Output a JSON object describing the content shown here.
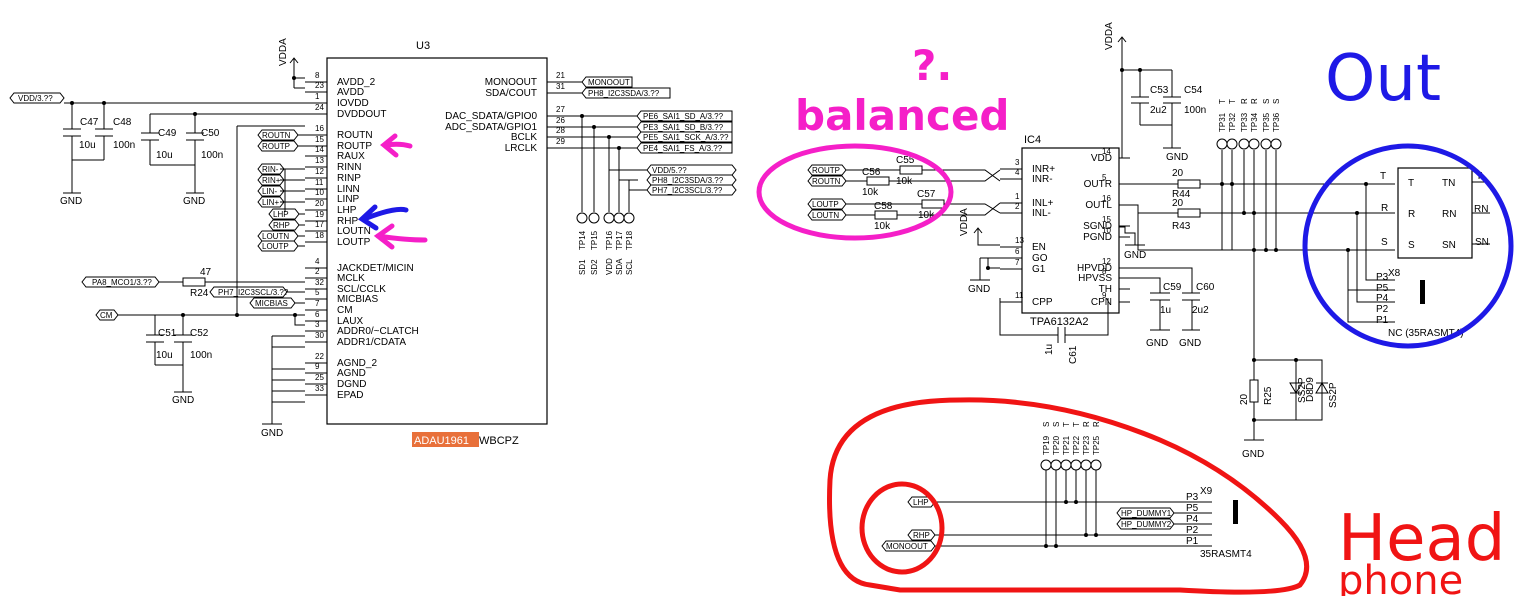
{
  "u3": {
    "ref": "U3",
    "part_highlight": "ADAU1961",
    "part_suffix": "WBCPZ",
    "left_pins": [
      {
        "num": "8",
        "name": "AVDD_2"
      },
      {
        "num": "23",
        "name": "AVDD"
      },
      {
        "num": "1",
        "name": "IOVDD"
      },
      {
        "num": "24",
        "name": "DVDDOUT"
      },
      {
        "num": "16",
        "name": "ROUTN"
      },
      {
        "num": "15",
        "name": "ROUTP"
      },
      {
        "num": "14",
        "name": "RAUX"
      },
      {
        "num": "13",
        "name": "RINN"
      },
      {
        "num": "12",
        "name": "RINP"
      },
      {
        "num": "11",
        "name": "LINN"
      },
      {
        "num": "10",
        "name": "LINP"
      },
      {
        "num": "20",
        "name": "LHP"
      },
      {
        "num": "19",
        "name": "RHP"
      },
      {
        "num": "17",
        "name": "LOUTN"
      },
      {
        "num": "18",
        "name": "LOUTP"
      },
      {
        "num": "4",
        "name": "JACKDET/MICIN"
      },
      {
        "num": "2",
        "name": "MCLK"
      },
      {
        "num": "32",
        "name": "SCL/CCLK"
      },
      {
        "num": "5",
        "name": "MICBIAS"
      },
      {
        "num": "7",
        "name": "CM"
      },
      {
        "num": "6",
        "name": "LAUX"
      },
      {
        "num": "3",
        "name": "ADDR0/~CLATCH"
      },
      {
        "num": "30",
        "name": "ADDR1/CDATA"
      },
      {
        "num": "22",
        "name": "AGND_2"
      },
      {
        "num": "9",
        "name": "AGND"
      },
      {
        "num": "25",
        "name": "DGND"
      },
      {
        "num": "33",
        "name": "EPAD"
      }
    ],
    "right_pins": [
      {
        "num": "21",
        "name": "MONOOUT"
      },
      {
        "num": "31",
        "name": "SDA/COUT"
      },
      {
        "num": "27",
        "name": "DAC_SDATA/GPIO0"
      },
      {
        "num": "26",
        "name": "ADC_SDATA/GPIO1"
      },
      {
        "num": "28",
        "name": "BCLK"
      },
      {
        "num": "29",
        "name": "LRCLK"
      }
    ],
    "right_nets": [
      "MONOOUT",
      "PH8_I2C3SDA/3.??",
      "PE6_SAI1_SD_A/3.??",
      "PE3_SAI1_SD_B/3.??",
      "PE5_SAI1_SCK_A/3.??",
      "PE4_SAI1_FS_A/3.??"
    ],
    "left_nets": [
      "ROUTN",
      "ROUTP",
      "RIN-",
      "RIN+",
      "LIN-",
      "LIN+",
      "LHP",
      "RHP",
      "LOUTN",
      "LOUTP"
    ]
  },
  "power": {
    "vdda_left": "VDDA",
    "vdd3": "VDD/3.??",
    "vdda_ic4": "VDDA",
    "vdda_top": "VDDA",
    "gnd": "GND"
  },
  "caps": {
    "c47": {
      "ref": "C47",
      "val": "10u"
    },
    "c48": {
      "ref": "C48",
      "val": "100n"
    },
    "c49": {
      "ref": "C49",
      "val": "10u"
    },
    "c50": {
      "ref": "C50",
      "val": "100n"
    },
    "c51": {
      "ref": "C51",
      "val": "10u"
    },
    "c52": {
      "ref": "C52",
      "val": "100n"
    },
    "c53": {
      "ref": "C53",
      "val": "2u2"
    },
    "c54": {
      "ref": "C54",
      "val": "100n"
    },
    "c59": {
      "ref": "C59",
      "val": "1u"
    },
    "c60": {
      "ref": "C60",
      "val": "2u2"
    },
    "c61": {
      "ref": "C61",
      "val": "1u"
    }
  },
  "misc_left": {
    "pa8": "PA8_MCO1/3.??",
    "r24_val": "47",
    "r24_ref": "R24",
    "ph7": "PH7_I2C3SCL/3.??",
    "micbias": "MICBIAS",
    "cm": "CM"
  },
  "testpoints_mid": {
    "sd": [
      "TP14",
      "TP15"
    ],
    "sd_labels": [
      "SD1",
      "SD2"
    ],
    "bus": [
      "TP16",
      "TP17",
      "TP18"
    ],
    "bus_labels": [
      "VDD",
      "SDA",
      "SCL"
    ],
    "nets": [
      "VDD/5.??",
      "PH8_I2C3SDA/3.??",
      "PH7_I2C3SCL/3.??"
    ]
  },
  "ic4": {
    "ref": "IC4",
    "part": "TPA6132A2",
    "left_pins": [
      {
        "num": "3",
        "name": "INR+"
      },
      {
        "num": "4",
        "name": "INR-"
      },
      {
        "num": "1",
        "name": "INL+"
      },
      {
        "num": "2",
        "name": "INL-"
      },
      {
        "num": "13",
        "name": "EN"
      },
      {
        "num": "6",
        "name": "GO"
      },
      {
        "num": "7",
        "name": "G1"
      },
      {
        "num": "11",
        "name": "CPP"
      }
    ],
    "right_pins": [
      {
        "num": "14",
        "name": "VDD"
      },
      {
        "num": "5",
        "name": "OUTR"
      },
      {
        "num": "16",
        "name": "OUTL"
      },
      {
        "num": "15",
        "name": "SGND"
      },
      {
        "num": "10",
        "name": "PGND"
      },
      {
        "num": "12",
        "name": "HPVDD"
      },
      {
        "num": "8",
        "name": "HPVSS"
      },
      {
        "num": "",
        "name": "TH"
      },
      {
        "num": "9",
        "name": "CPN"
      }
    ],
    "input_nets": [
      "ROUTP",
      "ROUTN",
      "LOUTP",
      "LOUTN"
    ],
    "c56": "C56",
    "c57": "C57",
    "c58": "C58",
    "r10k": "10k"
  },
  "out_res": {
    "r44": "R44",
    "r43": "R43",
    "r25": "R25",
    "val20": "20"
  },
  "tp_right": {
    "names": [
      "TP31",
      "TP32",
      "TP33",
      "TP34",
      "TP35",
      "TP36"
    ],
    "labels": [
      "T",
      "T",
      "R",
      "R",
      "S",
      "S"
    ]
  },
  "x8": {
    "ref": "X8",
    "pins": [
      "T",
      "R",
      "S"
    ],
    "right": [
      "TN",
      "RN",
      "SN"
    ],
    "p": [
      "P3",
      "P5",
      "P4",
      "P2",
      "P1"
    ],
    "part": "NC (35RASMT4)"
  },
  "diodes": {
    "d8": "D8",
    "d9": "D9",
    "type": "SS2P"
  },
  "x9": {
    "ref": "X9",
    "part": "35RASMT4",
    "p": [
      "P3",
      "P5",
      "P4",
      "P2",
      "P1"
    ],
    "nets": [
      "LHP",
      "HP_DUMMY1",
      "HP_DUMMY2",
      "RHP",
      "MONOOUT"
    ]
  },
  "tp_bottom": {
    "names": [
      "TP19",
      "TP20",
      "TP21",
      "TP22",
      "TP23",
      "TP25"
    ],
    "labels": [
      "S",
      "S",
      "T",
      "T",
      "R",
      "R"
    ]
  },
  "annotations": {
    "balanced": "balanced",
    "question": "?.",
    "out": "Out",
    "head": "Head",
    "phone": "phone"
  },
  "colors": {
    "magenta": "#f51fc8",
    "blue": "#1e19e6",
    "red": "#f01414",
    "highlight": "#e8703a"
  }
}
